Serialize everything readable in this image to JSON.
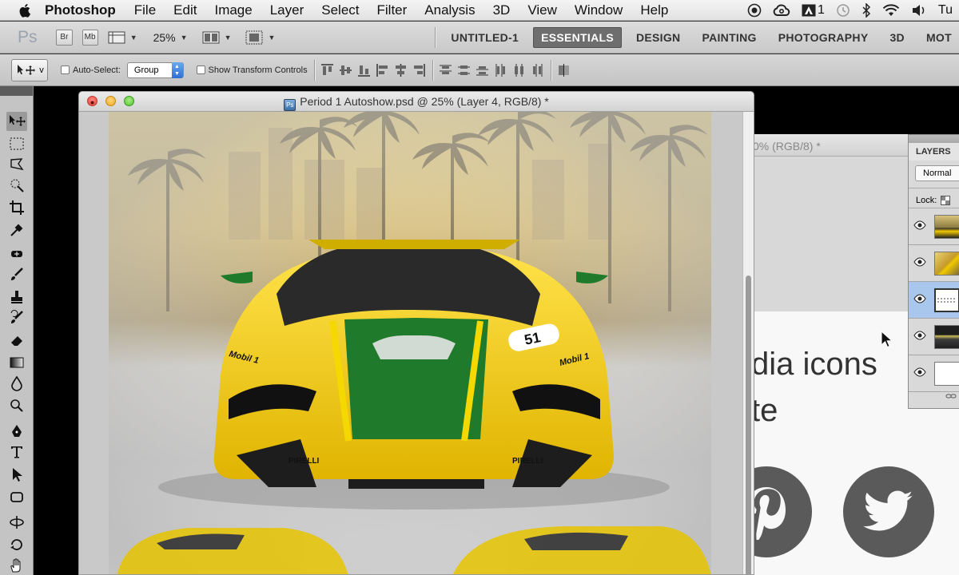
{
  "menubar": {
    "app_name": "Photoshop",
    "items": [
      "File",
      "Edit",
      "Image",
      "Layer",
      "Select",
      "Filter",
      "Analysis",
      "3D",
      "View",
      "Window",
      "Help"
    ],
    "status": {
      "adobe_badge": "1",
      "clock": "Tu"
    }
  },
  "appbar": {
    "logo": "Ps",
    "bridge_label": "Br",
    "minibridge_label": "Mb",
    "zoom": "25%",
    "workspaces": [
      "UNTITLED-1",
      "ESSENTIALS",
      "DESIGN",
      "PAINTING",
      "PHOTOGRAPHY",
      "3D",
      "MOT"
    ],
    "active_workspace": "ESSENTIALS"
  },
  "options": {
    "auto_select_label": "Auto-Select:",
    "auto_select_value": "Group",
    "transform_label": "Show Transform Controls",
    "preset_caret": "v"
  },
  "document": {
    "title": "Period 1 Autoshow.psd @ 25% (Layer 4, RGB/8) *",
    "car_number": "51",
    "sponsor": "Mobil 1",
    "tyre_brand": "PIRELLI"
  },
  "second_document": {
    "title_fragment": "0% (RGB/8) *",
    "heading_line1": "dia icons",
    "heading_line2": "te",
    "icons": [
      "pinterest-icon",
      "twitter-icon"
    ]
  },
  "layers_panel": {
    "tab": "LAYERS",
    "blend_mode": "Normal",
    "lock_label": "Lock:",
    "selected_layer": 2,
    "layer_count": 5
  },
  "colors": {
    "accent_blue": "#2f6fd4",
    "car_yellow": "#f2c800",
    "car_green": "#1f7a2c",
    "social_grey": "#5a5a5a"
  }
}
